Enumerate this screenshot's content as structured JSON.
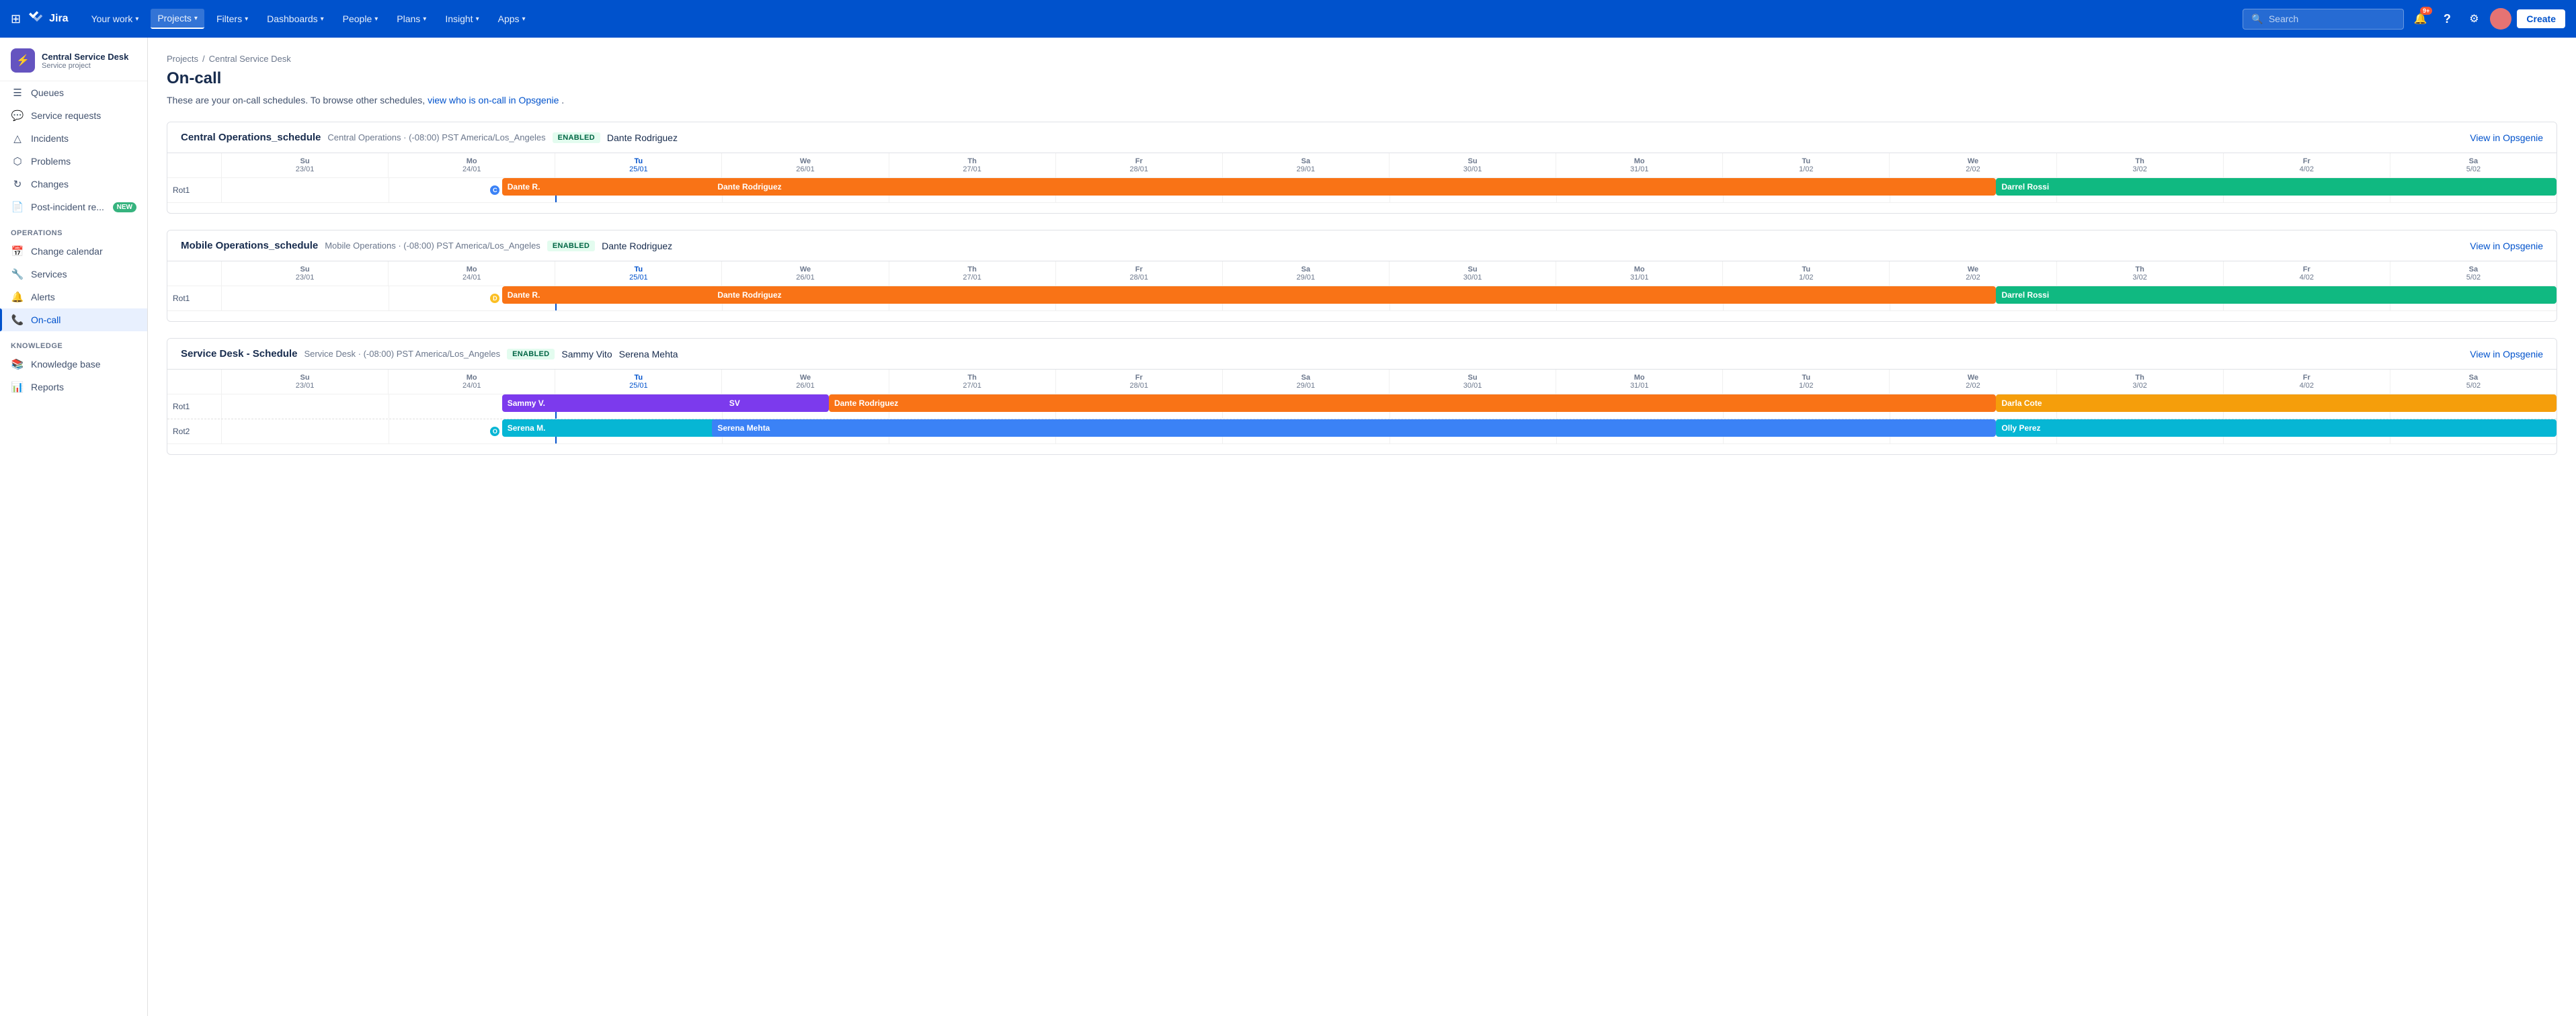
{
  "topnav": {
    "logo_text": "Jira",
    "nav_items": [
      {
        "id": "your-work",
        "label": "Your work",
        "has_chevron": true
      },
      {
        "id": "projects",
        "label": "Projects",
        "has_chevron": true,
        "active": true
      },
      {
        "id": "filters",
        "label": "Filters",
        "has_chevron": true
      },
      {
        "id": "dashboards",
        "label": "Dashboards",
        "has_chevron": true
      },
      {
        "id": "people",
        "label": "People",
        "has_chevron": true
      },
      {
        "id": "plans",
        "label": "Plans",
        "has_chevron": true
      },
      {
        "id": "insight",
        "label": "Insight",
        "has_chevron": true
      },
      {
        "id": "apps",
        "label": "Apps",
        "has_chevron": true
      }
    ],
    "create_label": "Create",
    "search_placeholder": "Search",
    "notification_badge": "9+"
  },
  "sidebar": {
    "project_name": "Central Service Desk",
    "project_type": "Service project",
    "items": [
      {
        "id": "queues",
        "label": "Queues",
        "icon": "☰"
      },
      {
        "id": "service-requests",
        "label": "Service requests",
        "icon": "💬"
      },
      {
        "id": "incidents",
        "label": "Incidents",
        "icon": "△"
      },
      {
        "id": "problems",
        "label": "Problems",
        "icon": "⬡"
      },
      {
        "id": "changes",
        "label": "Changes",
        "icon": "↻"
      },
      {
        "id": "post-incident",
        "label": "Post-incident re...",
        "icon": "📄",
        "new": true
      }
    ],
    "operations_section": "OPERATIONS",
    "operations_items": [
      {
        "id": "change-calendar",
        "label": "Change calendar",
        "icon": "📅"
      },
      {
        "id": "services",
        "label": "Services",
        "icon": "🔧"
      },
      {
        "id": "alerts",
        "label": "Alerts",
        "icon": "🔔"
      },
      {
        "id": "on-call",
        "label": "On-call",
        "icon": "📞",
        "active": true
      }
    ],
    "knowledge_section": "KNOWLEDGE",
    "knowledge_items": [
      {
        "id": "knowledge-base",
        "label": "Knowledge base",
        "icon": "📚"
      },
      {
        "id": "reports",
        "label": "Reports",
        "icon": "📊"
      }
    ]
  },
  "page": {
    "breadcrumb_projects": "Projects",
    "breadcrumb_project": "Central Service Desk",
    "title": "On-call",
    "description_prefix": "These are your on-call schedules. To browse other schedules,",
    "description_link": "view who is on-call in Opsgenie",
    "description_suffix": "."
  },
  "schedules": [
    {
      "id": "central-ops",
      "name": "Central Operations_schedule",
      "meta": "Central Operations · (-08:00) PST America/Los_Angeles",
      "enabled": "ENABLED",
      "oncall": "Dante Rodriguez",
      "view_link": "View in Opsgenie",
      "columns": [
        "Su 23/01",
        "Mo 24/01",
        "Tu 25/01",
        "We 26/01",
        "Th 27/01",
        "Fr 28/01",
        "Sa 29/01",
        "Su 30/01",
        "Mo 31/01",
        "Tu 1/02",
        "We 2/02",
        "Th 3/02",
        "Fr 4/02",
        "Sa 5/02"
      ],
      "today_col": 2,
      "rows": [
        {
          "label": "Rot1",
          "bars": [
            {
              "color": "#f97316",
              "label": "Dante R.",
              "start_frac": 0.12,
              "width_frac": 0.155,
              "has_dot": true,
              "dot_color": "#3b82f6",
              "dot_label": "C"
            },
            {
              "color": "#f97316",
              "label": "Dante Rodriguez",
              "start_frac": 0.21,
              "width_frac": 0.55
            },
            {
              "color": "#10b981",
              "label": "Darrel Rossi",
              "start_frac": 0.76,
              "width_frac": 0.24
            }
          ]
        }
      ]
    },
    {
      "id": "mobile-ops",
      "name": "Mobile Operations_schedule",
      "meta": "Mobile Operations · (-08:00) PST America/Los_Angeles",
      "enabled": "ENABLED",
      "oncall": "Dante Rodriguez",
      "view_link": "View in Opsgenie",
      "columns": [
        "Su 23/01",
        "Mo 24/01",
        "Tu 25/01",
        "We 26/01",
        "Th 27/01",
        "Fr 28/01",
        "Sa 29/01",
        "Su 30/01",
        "Mo 31/01",
        "Tu 1/02",
        "We 2/02",
        "Th 3/02",
        "Fr 4/02",
        "Sa 5/02"
      ],
      "today_col": 2,
      "rows": [
        {
          "label": "Rot1",
          "bars": [
            {
              "color": "#f97316",
              "label": "Dante R.",
              "start_frac": 0.12,
              "width_frac": 0.155,
              "has_dot": true,
              "dot_color": "#fbbf24",
              "dot_label": "D"
            },
            {
              "color": "#f97316",
              "label": "Dante Rodriguez",
              "start_frac": 0.21,
              "width_frac": 0.55
            },
            {
              "color": "#10b981",
              "label": "Darrel Rossi",
              "start_frac": 0.76,
              "width_frac": 0.24
            }
          ]
        }
      ]
    },
    {
      "id": "service-desk",
      "name": "Service Desk - Schedule",
      "meta": "Service Desk · (-08:00) PST America/Los_Angeles",
      "enabled": "ENABLED",
      "oncall_users": [
        "Sammy Vito",
        "Serena Mehta"
      ],
      "view_link": "View in Opsgenie",
      "columns": [
        "Su 23/01",
        "Mo 24/01",
        "Tu 25/01",
        "We 26/01",
        "Th 27/01",
        "Fr 28/01",
        "Sa 29/01",
        "Su 30/01",
        "Mo 31/01",
        "Tu 1/02",
        "We 2/02",
        "Th 3/02",
        "Fr 4/02",
        "Sa 5/02"
      ],
      "today_col": 2,
      "rows": [
        {
          "label": "Rot1",
          "bars": [
            {
              "color": "#7c3aed",
              "label": "Sammy V.",
              "start_frac": 0.12,
              "width_frac": 0.1
            },
            {
              "color": "#7c3aed",
              "label": "SV",
              "start_frac": 0.215,
              "width_frac": 0.045
            },
            {
              "color": "#f97316",
              "label": "Dante Rodriguez",
              "start_frac": 0.26,
              "width_frac": 0.5
            },
            {
              "color": "#f59e0b",
              "label": "Darla Cote",
              "start_frac": 0.76,
              "width_frac": 0.24
            }
          ]
        },
        {
          "label": "Rot2",
          "bars": [
            {
              "color": "#06b6d4",
              "label": "Serena M.",
              "start_frac": 0.12,
              "width_frac": 0.155,
              "has_dot": true,
              "dot_color": "#06b6d4",
              "dot_label": "O"
            },
            {
              "color": "#3b82f6",
              "label": "Serena Mehta",
              "start_frac": 0.21,
              "width_frac": 0.55
            },
            {
              "color": "#06b6d4",
              "label": "Olly Perez",
              "start_frac": 0.76,
              "width_frac": 0.24
            }
          ]
        }
      ]
    }
  ]
}
